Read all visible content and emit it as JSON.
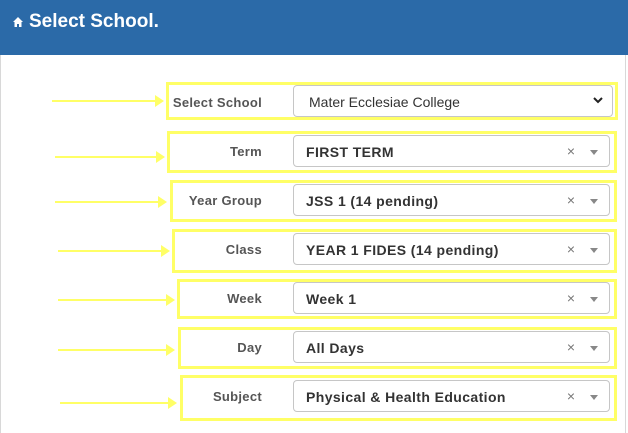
{
  "header": {
    "title": "Select School.",
    "icon": "home-icon"
  },
  "accent": {
    "header_bg": "#2b6aa8",
    "highlight": "#ffff66"
  },
  "form": {
    "school": {
      "label": "Select School",
      "value": "Mater Ecclesiae College"
    },
    "term": {
      "label": "Term",
      "value": "FIRST TERM",
      "clear": "×"
    },
    "year_group": {
      "label": "Year Group",
      "value": "JSS 1 (14 pending)",
      "clear": "×"
    },
    "class": {
      "label": "Class",
      "value": "YEAR 1 FIDES (14 pending)",
      "clear": "×"
    },
    "week": {
      "label": "Week",
      "value": "Week 1",
      "clear": "×"
    },
    "day": {
      "label": "Day",
      "value": "All Days",
      "clear": "×"
    },
    "subject": {
      "label": "Subject",
      "value": "Physical & Health Education",
      "clear": "×"
    }
  }
}
